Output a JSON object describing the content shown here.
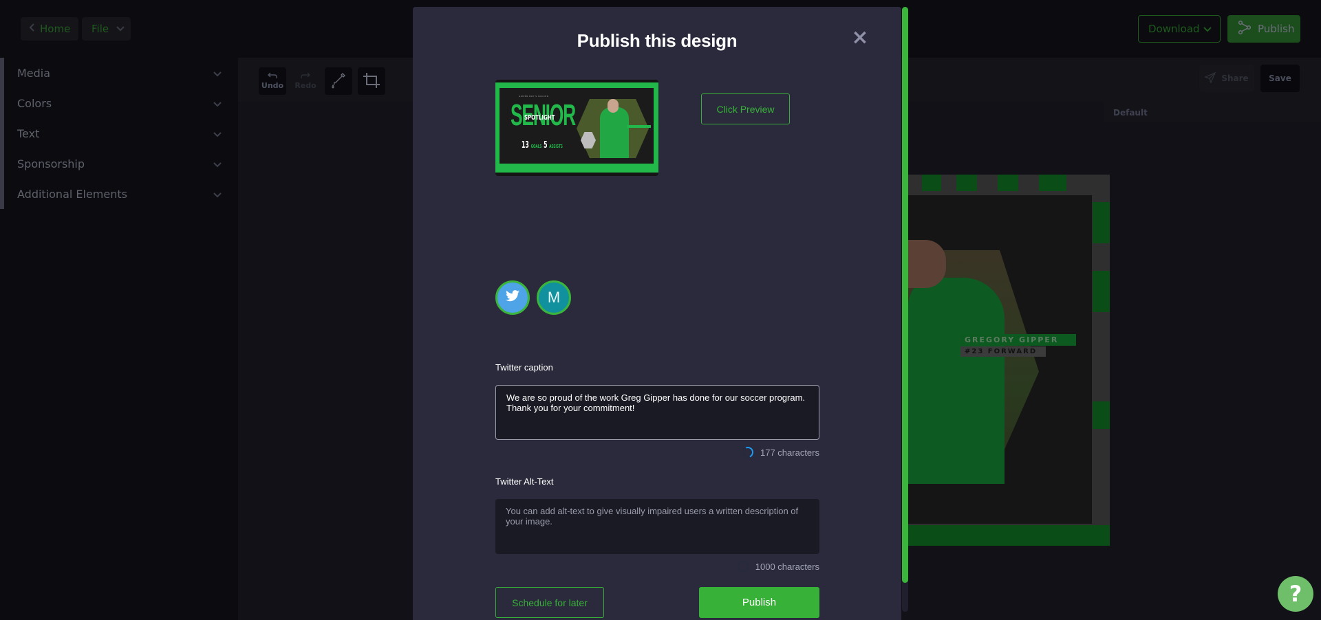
{
  "topbar": {
    "home_label": "Home",
    "file_label": "File",
    "download_label": "Download",
    "publish_label": "Publish"
  },
  "sidebar": {
    "items": [
      {
        "label": "Media"
      },
      {
        "label": "Colors"
      },
      {
        "label": "Text"
      },
      {
        "label": "Sponsorship"
      },
      {
        "label": "Additional Elements"
      }
    ]
  },
  "toolbar": {
    "undo_label": "Undo",
    "redo_label": "Redo",
    "share_label": "Share",
    "save_label": "Save",
    "page_label": "Default"
  },
  "design": {
    "player_name": "GREGORY GIPPER",
    "player_position": "#23 FORWARD"
  },
  "thumbnail": {
    "subtitle": "GIPPER BOY'S SOCCER",
    "headline": "SENIOR",
    "overlay": "SPOTLIGHT",
    "stat1_value": "13",
    "stat1_label": "GOALS",
    "stat2_value": "5",
    "stat2_label": "ASSISTS"
  },
  "modal": {
    "title": "Publish this design",
    "close_icon": "×",
    "preview_label": "Click Preview",
    "mastodon_letter": "M",
    "caption_label": "Twitter caption",
    "caption_value": "We are so proud of the work Greg Gipper has done for our soccer program. Thank you for your commitment!",
    "caption_counter": "177 characters",
    "alttext_label": "Twitter Alt-Text",
    "alttext_placeholder": "You can add alt-text to give visually impaired users a written description of your image.",
    "alttext_counter": "1000 characters",
    "schedule_label": "Schedule for later",
    "publish_label": "Publish"
  },
  "help": {
    "label": "?"
  },
  "colors": {
    "accent": "#38b138",
    "modal_bg": "#2a2a3c",
    "twitter": "#4ea4e6",
    "mastodon": "#11919e"
  }
}
